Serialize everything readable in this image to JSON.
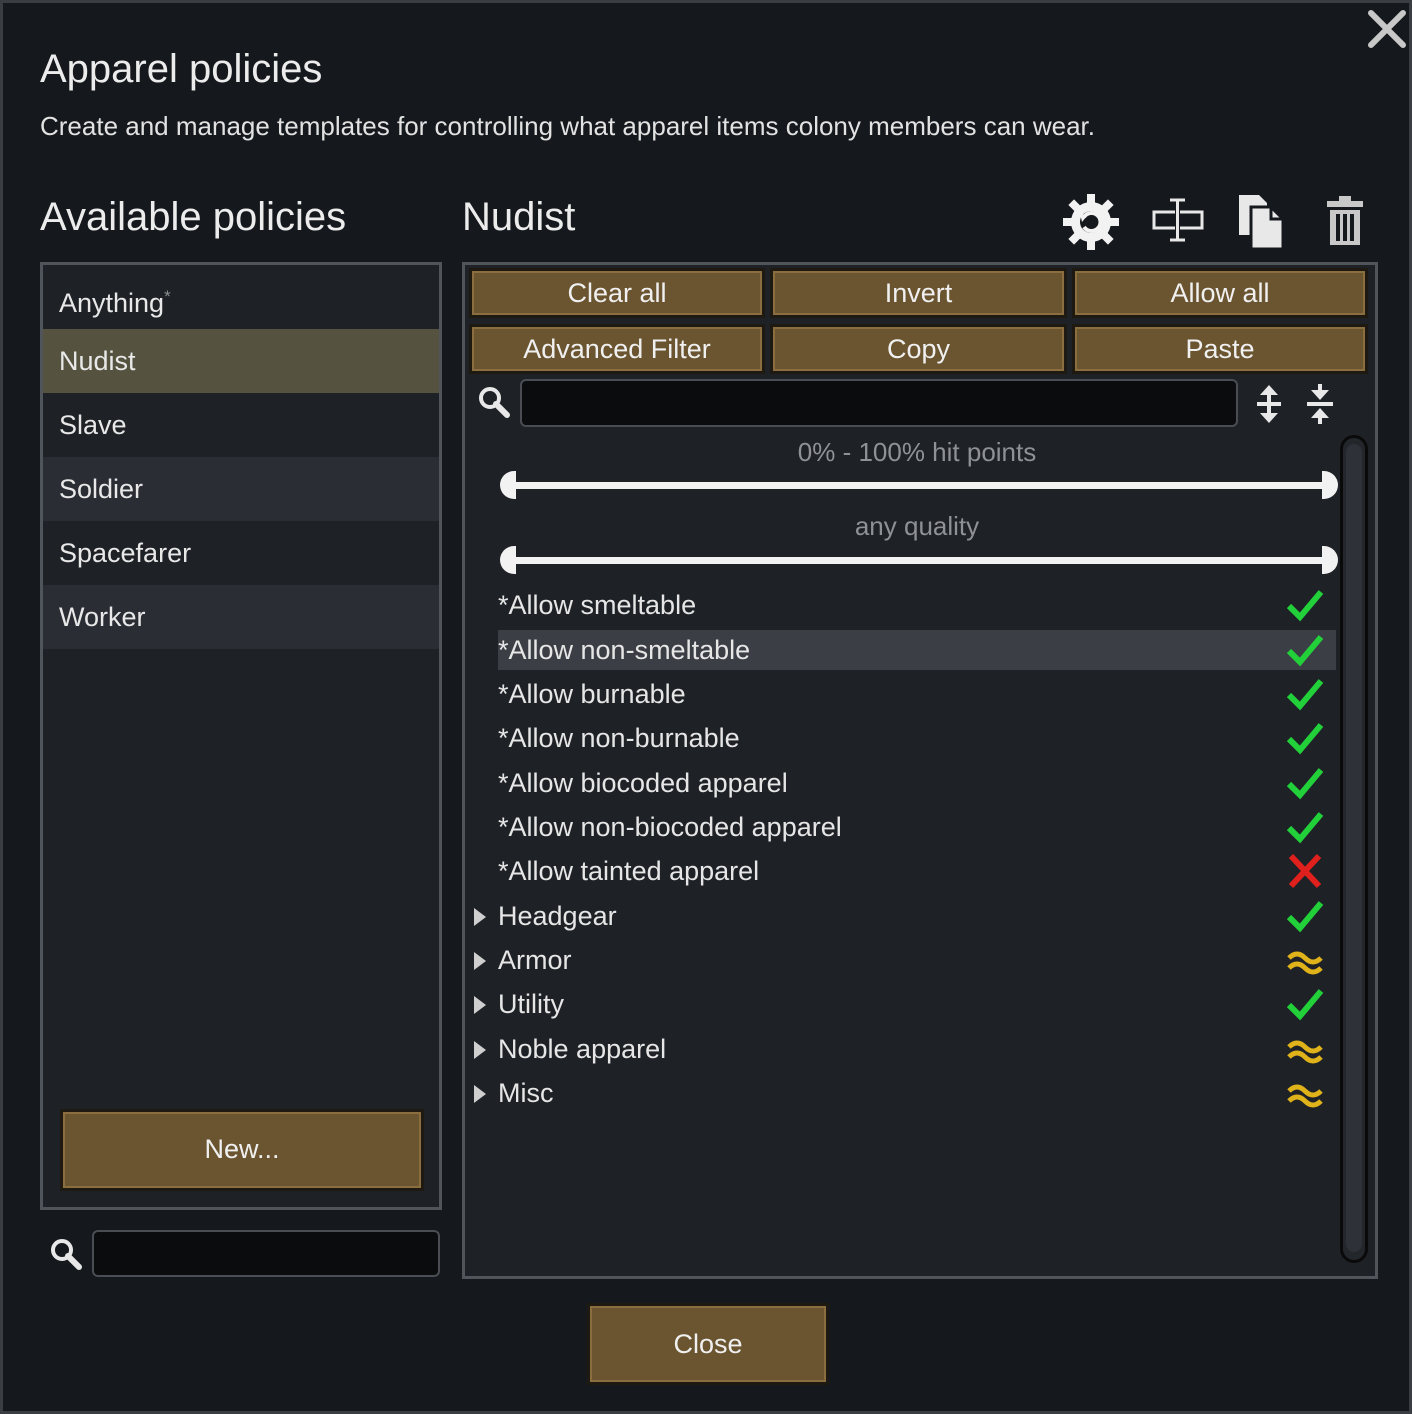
{
  "dialog": {
    "title": "Apparel policies",
    "subtitle": "Create and manage templates for controlling what apparel items colony members can wear."
  },
  "left": {
    "heading": "Available policies",
    "policies": [
      {
        "label": "Anything",
        "star": "*"
      },
      {
        "label": "Nudist",
        "selected": true
      },
      {
        "label": "Slave"
      },
      {
        "label": "Soldier"
      },
      {
        "label": "Spacefarer"
      },
      {
        "label": "Worker"
      }
    ],
    "new_button": "New...",
    "search_value": ""
  },
  "right": {
    "policy_name": "Nudist",
    "toolbar_icons": [
      "gear-icon",
      "rename-icon",
      "duplicate-icon",
      "trash-icon"
    ],
    "buttons": {
      "clear_all": "Clear all",
      "invert": "Invert",
      "allow_all": "Allow all",
      "advanced_filter": "Advanced Filter",
      "copy": "Copy",
      "paste": "Paste"
    },
    "search_value": "",
    "hit_points_label": "0% - 100% hit points",
    "hit_points_range": [
      0,
      100
    ],
    "quality_label": "any quality",
    "filters": [
      {
        "label": "*Allow smeltable",
        "state": "check"
      },
      {
        "label": "*Allow non-smeltable",
        "state": "check",
        "highlighted": true
      },
      {
        "label": "*Allow burnable",
        "state": "check"
      },
      {
        "label": "*Allow non-burnable",
        "state": "check"
      },
      {
        "label": "*Allow biocoded apparel",
        "state": "check"
      },
      {
        "label": "*Allow non-biocoded apparel",
        "state": "check"
      },
      {
        "label": "*Allow tainted apparel",
        "state": "cross"
      }
    ],
    "categories": [
      {
        "label": "Headgear",
        "state": "check"
      },
      {
        "label": "Armor",
        "state": "partial"
      },
      {
        "label": "Utility",
        "state": "check"
      },
      {
        "label": "Noble apparel",
        "state": "partial"
      },
      {
        "label": "Misc",
        "state": "partial"
      }
    ]
  },
  "footer": {
    "close_button": "Close"
  },
  "colors": {
    "button_fill": "#6b5530",
    "check": "#22d13a",
    "cross": "#e0201c",
    "partial": "#e0b31a",
    "selected_row": "#55533f"
  }
}
